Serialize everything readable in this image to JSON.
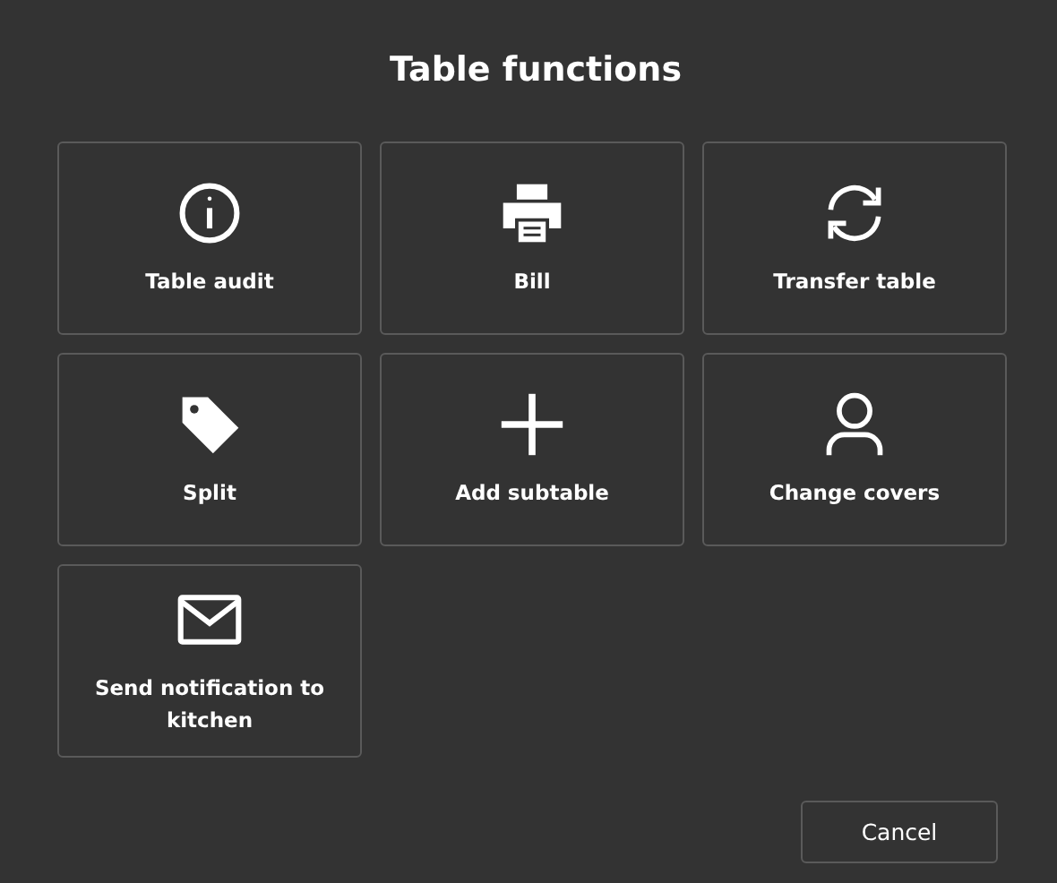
{
  "dialog": {
    "title": "Table functions",
    "tiles": [
      {
        "kind": "info",
        "label": "Table audit"
      },
      {
        "kind": "printer",
        "label": "Bill"
      },
      {
        "kind": "refresh",
        "label": "Transfer table"
      },
      {
        "kind": "tag",
        "label": "Split"
      },
      {
        "kind": "plus",
        "label": "Add subtable"
      },
      {
        "kind": "person",
        "label": "Change covers"
      },
      {
        "kind": "mail",
        "label": "Send notification to kitchen"
      }
    ],
    "cancel": "Cancel"
  }
}
